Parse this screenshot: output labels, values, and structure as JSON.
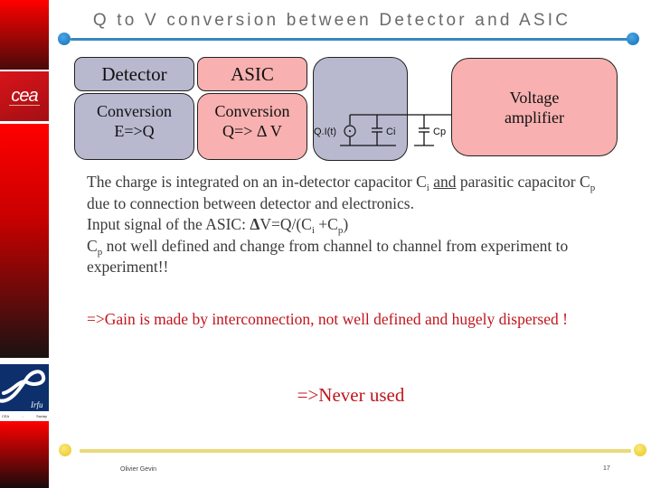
{
  "title": "Q to V conversion between Detector and ASIC",
  "sidebar": {
    "logo_top": "cea",
    "logo_bottom_caption_left": "CEA",
    "logo_bottom_caption_mid": "-",
    "logo_bottom_caption_right": "Saclay",
    "logo_bottom_script": "Irfu"
  },
  "diagram": {
    "detector_header": "Detector",
    "asic_header": "ASIC",
    "detector_conv_line1": "Conversion",
    "detector_conv_line2": "E=>Q",
    "asic_conv_line1": "Conversion",
    "asic_conv_line2": "Q=> Δ V",
    "circuit_source_label": "Q.I(t)",
    "circuit_ci_label": "Ci",
    "circuit_cp_label": "Cp",
    "amp_line1": "Voltage",
    "amp_line2": "amplifier"
  },
  "body": {
    "p1_a": "The charge is integrated on an in-detector capacitor C",
    "p1_sub_i": "i",
    "p1_and": "and",
    "p1_b": " parasitic capacitor C",
    "p1_sub_p": "p",
    "p1_c": " due to connection between detector and electronics.",
    "p2_a": "Input signal of the ASIC: ",
    "p2_delta": "Δ",
    "p2_b": "V=Q/(C",
    "p2_sub_i": "i",
    "p2_c": " +C",
    "p2_sub_p": "p",
    "p2_d": ")",
    "p3_a": "C",
    "p3_sub_p": "p",
    "p3_b": " not well defined and change from channel to channel from experiment to experiment!!"
  },
  "conclusion_1": "=>Gain is made by interconnection, not well defined and hugely dispersed !",
  "conclusion_2": "=>Never used",
  "footer": {
    "author": "Olivier Gevin",
    "page": "17"
  },
  "colors": {
    "accent_red": "#c0151c",
    "title_rule_blue": "#3a87c0",
    "footer_rule_yellow": "#ecd97a",
    "box_gray": "#b8b9cf",
    "box_pink": "#f8b0b0"
  }
}
